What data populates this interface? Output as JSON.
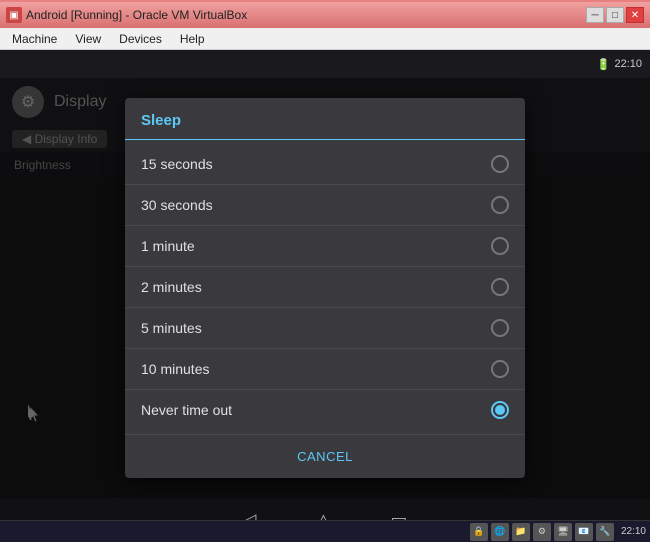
{
  "window": {
    "title": "Android [Running] - Oracle VM VirtualBox",
    "icon": "▣"
  },
  "menu": {
    "items": [
      "Machine",
      "View",
      "Devices",
      "Help"
    ]
  },
  "status_bar": {
    "battery_icon": "🔋",
    "time": "22:10"
  },
  "display_header": {
    "gear_icon": "⚙",
    "title": "Display"
  },
  "breadcrumb": {
    "label": "◀  Display Info"
  },
  "section": {
    "brightness_label": "Brightness"
  },
  "dialog": {
    "title": "Sleep",
    "options": [
      {
        "id": "opt-15s",
        "label": "15 seconds",
        "selected": false
      },
      {
        "id": "opt-30s",
        "label": "30 seconds",
        "selected": false
      },
      {
        "id": "opt-1m",
        "label": "1 minute",
        "selected": false
      },
      {
        "id": "opt-2m",
        "label": "2 minutes",
        "selected": false
      },
      {
        "id": "opt-5m",
        "label": "5 minutes",
        "selected": false
      },
      {
        "id": "opt-10m",
        "label": "10 minutes",
        "selected": false
      },
      {
        "id": "opt-never",
        "label": "Never time out",
        "selected": true
      }
    ],
    "cancel_label": "Cancel"
  },
  "nav_bar": {
    "back_icon": "◁",
    "home_icon": "△",
    "recent_icon": "▭"
  },
  "taskbar": {
    "icons": [
      "🔒",
      "🌐",
      "📁",
      "⚙",
      "🖥",
      "📧",
      "🔧"
    ],
    "time": "22:10"
  },
  "title_controls": {
    "minimize": "─",
    "restore": "□",
    "close": "✕"
  }
}
